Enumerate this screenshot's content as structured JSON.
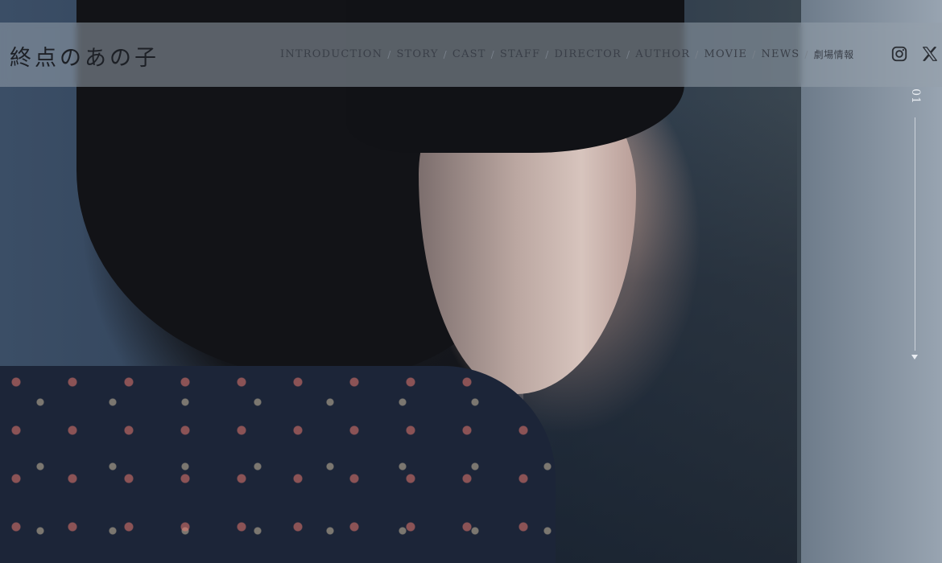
{
  "logo": {
    "text": "終点のあの子"
  },
  "nav": {
    "items": [
      {
        "label": "INTRODUCTION"
      },
      {
        "label": "STORY"
      },
      {
        "label": "CAST"
      },
      {
        "label": "STAFF"
      },
      {
        "label": "DIRECTOR"
      },
      {
        "label": "AUTHOR"
      },
      {
        "label": "MOVIE"
      },
      {
        "label": "NEWS"
      },
      {
        "label": "劇場情報"
      }
    ],
    "separator": "/"
  },
  "social": {
    "icons": [
      "instagram-icon",
      "x-icon"
    ]
  },
  "scroll": {
    "slide_number": "01"
  },
  "colors": {
    "bar": "#96a0ac",
    "text": "#3a3f48",
    "indicator": "#e9edf2"
  }
}
